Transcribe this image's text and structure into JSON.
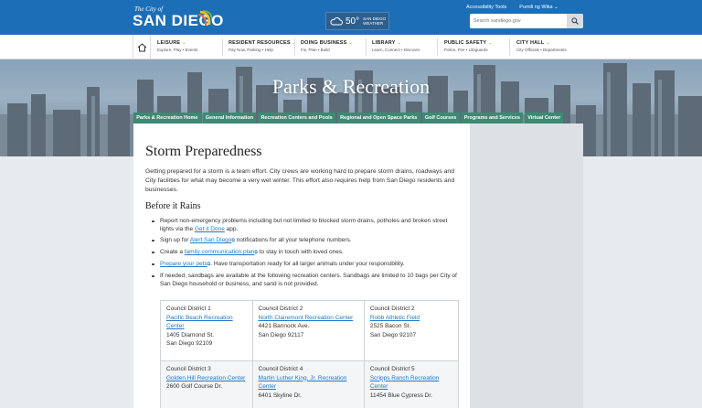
{
  "header": {
    "logo_small": "The City of",
    "logo_big": "SAN DIEGO",
    "weather_temp": "50°",
    "weather_label_1": "SAN DIEGO",
    "weather_label_2": "WEATHER",
    "accessibility": "Accessibility Tools",
    "language": "Pumili ng Wika",
    "search_placeholder": "Search sandiego.gov"
  },
  "nav": [
    {
      "title": "LEISURE",
      "sub": "Explore, Play • Events"
    },
    {
      "title": "RESIDENT RESOURCES",
      "sub": "Pay Now, Parking • Help"
    },
    {
      "title": "DOING BUSINESS",
      "sub": "Fix, Plan • Build"
    },
    {
      "title": "LIBRARY",
      "sub": "Learn, Connect • Discover"
    },
    {
      "title": "PUBLIC SAFETY",
      "sub": "Police, Fire • Lifeguards"
    },
    {
      "title": "CITY HALL",
      "sub": "City Officials • Departments"
    }
  ],
  "hero_title": "Parks & Recreation",
  "tabs": [
    "Parks & Recreation Home",
    "General Information",
    "Recreation Centers and Pools",
    "Regional and Open Space Parks",
    "Golf Courses",
    "Programs and Services",
    "Virtual Center"
  ],
  "content": {
    "title": "Storm Preparedness",
    "intro": "Getting prepared for a storm is a team effort. City crews are working hard to prepare storm drains, roadways and City facilities for what may become a very wet winter. This effort also requires help from San Diego residents and businesses.",
    "section": "Before it Rains",
    "b1_pre": "Report non-emergency problems including but not limited to blocked storm drains, potholes and broken street lights via the ",
    "b1_link": "Get it Done",
    "b1_post": " app.",
    "b2_pre": "Sign up for ",
    "b2_link": "Alert San Diego",
    "b2_post": " notifications for all your telephone numbers.",
    "b3_pre": "Create a ",
    "b3_link": "family communication plan",
    "b3_post": " to stay in touch with loved ones.",
    "b4_link": "Prepare your pets",
    "b4_post": ". Have transportation ready for all larger animals under your responsibility.",
    "b5": "If needed, sandbags are available at the following recreation centers. Sandbags are limited to 10 bags per City of San Diego household or business, and sand is not provided."
  },
  "locations": [
    {
      "district": "Council District 1",
      "name": "Pacific Beach Recreation Center",
      "street": "1405 Diamond St.",
      "city": "San Diego 92109"
    },
    {
      "district": "Council District 2",
      "name": "North Clairemont Recreation Center",
      "street": "4421 Bannock Ave.",
      "city": "San Diego 92117"
    },
    {
      "district": "Council District 2",
      "name": "Robb Athletic Field",
      "street": "2525 Bacon St.",
      "city": "San Diego 92107"
    },
    {
      "district": "Council District 3",
      "name": "Golden Hill Recreation Center",
      "street": "2600 Golf Course Dr.",
      "city": ""
    },
    {
      "district": "Council District 4",
      "name": "Martin Luther King, Jr. Recreation Center",
      "street": "6401 Skyline Dr.",
      "city": ""
    },
    {
      "district": "Council District 5",
      "name": "Scripps Ranch Recreation Center",
      "street": "11454 Blue Cypress Dr.",
      "city": ""
    }
  ],
  "colors": {
    "header_blue": "#1c6eb6",
    "tab_green": "#3d8a73",
    "link_blue": "#1f78c8"
  }
}
